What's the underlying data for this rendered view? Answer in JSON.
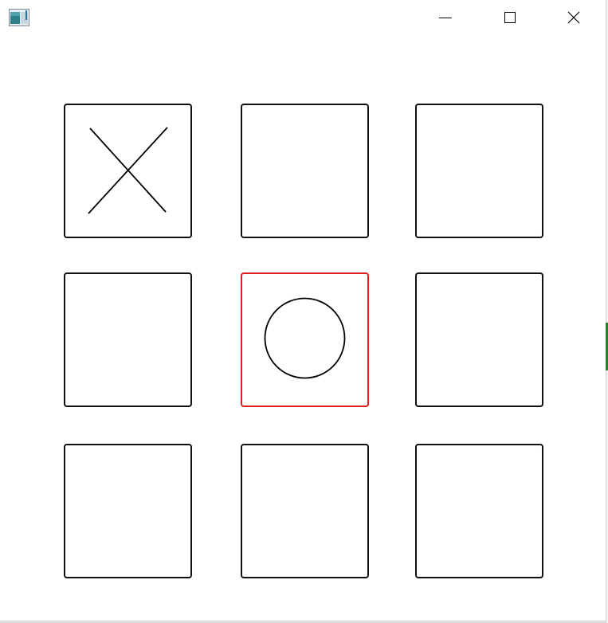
{
  "window": {
    "app_icon": "app-window-icon",
    "controls": [
      {
        "name": "minimize-button",
        "icon": "minimize-icon"
      },
      {
        "name": "maximize-button",
        "icon": "maximize-icon"
      },
      {
        "name": "close-button",
        "icon": "close-icon"
      }
    ]
  },
  "board": {
    "cells": [
      {
        "row": 1,
        "col": 1,
        "mark": "X",
        "selected": false
      },
      {
        "row": 1,
        "col": 2,
        "mark": "",
        "selected": false
      },
      {
        "row": 1,
        "col": 3,
        "mark": "",
        "selected": false
      },
      {
        "row": 2,
        "col": 1,
        "mark": "",
        "selected": false
      },
      {
        "row": 2,
        "col": 2,
        "mark": "O",
        "selected": true
      },
      {
        "row": 2,
        "col": 3,
        "mark": "",
        "selected": false
      },
      {
        "row": 3,
        "col": 1,
        "mark": "",
        "selected": false
      },
      {
        "row": 3,
        "col": 2,
        "mark": "",
        "selected": false
      },
      {
        "row": 3,
        "col": 3,
        "mark": "",
        "selected": false
      }
    ]
  },
  "colors": {
    "cell_border": "#111111",
    "selected_border": "#e01e1e",
    "mark": "#000000"
  }
}
